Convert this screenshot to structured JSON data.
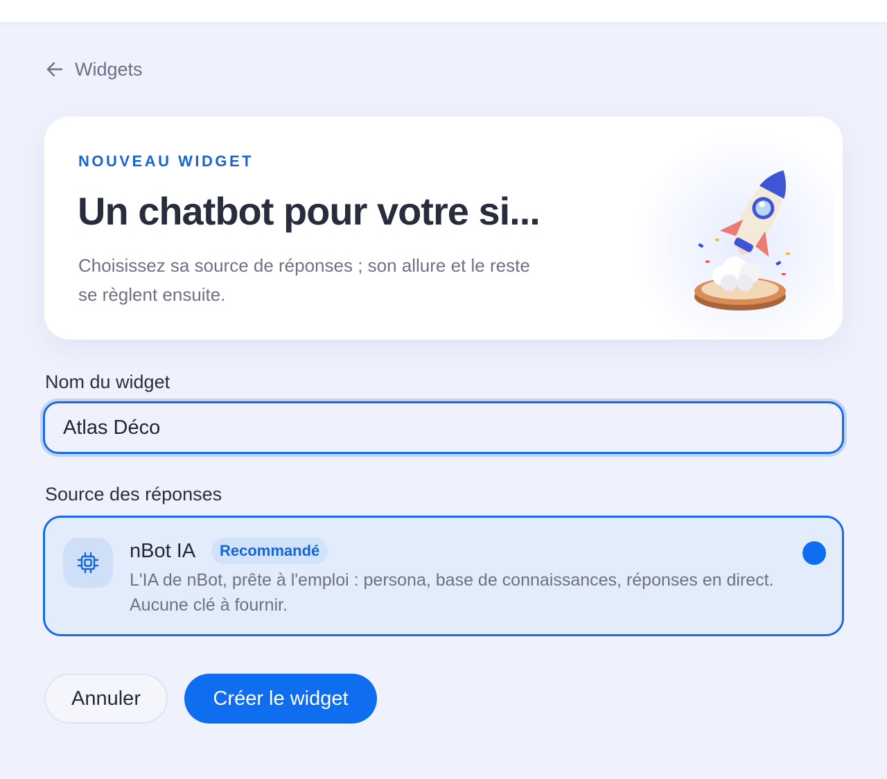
{
  "back": {
    "label": "Widgets",
    "icon": "arrow-left-icon"
  },
  "hero": {
    "eyebrow": "NOUVEAU WIDGET",
    "title": "Un chatbot pour votre si...",
    "subtitle": "Choisissez sa source de réponses ; son allure et le reste se règlent ensuite.",
    "illustration": "rocket-launch-illustration"
  },
  "form": {
    "name_label": "Nom du widget",
    "name_value": "Atlas Déco",
    "source_label": "Source des réponses",
    "source_option": {
      "name": "nBot IA",
      "badge": "Recommandé",
      "description": "L'IA de nBot, prête à l'emploi : persona, base de connaissances, réponses en direct. Aucune clé à fournir.",
      "icon": "chip-icon",
      "selected": true
    }
  },
  "actions": {
    "cancel_label": "Annuler",
    "create_label": "Créer le widget"
  },
  "colors": {
    "accent": "#0f6ef0",
    "background": "#eff2fc",
    "selected_card": "#e3ecfb"
  }
}
